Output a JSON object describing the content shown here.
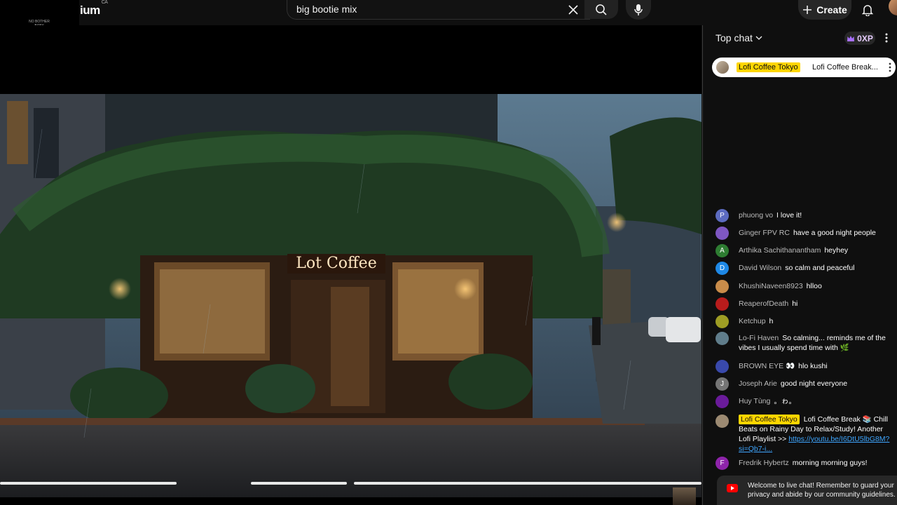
{
  "header": {
    "logo_tiny_text": "NO BOTHER BABY",
    "brand": "ium",
    "brand_region": "CA",
    "search_value": "big bootie mix",
    "create_label": "Create"
  },
  "video": {
    "sign_text": "Lot Coffee",
    "progress_fraction": 0.86
  },
  "chat": {
    "title": "Top chat",
    "xp": "0XP",
    "pinned": {
      "author": "Lofi Coffee Tokyo",
      "text": "Lofi Coffee Break..."
    },
    "messages": [
      {
        "author": "phuong vo",
        "text": "I love it!",
        "avatar": "P",
        "color": "#5c6bc0"
      },
      {
        "author": "Ginger FPV RC",
        "text": "have a good night people",
        "avatar": "",
        "color": "#7e57c2"
      },
      {
        "author": "Arthika Sachithanantham",
        "text": "heyhey",
        "avatar": "A",
        "color": "#2e7d32"
      },
      {
        "author": "David Wilson",
        "text": "so calm and peaceful",
        "avatar": "D",
        "color": "#1e88e5"
      },
      {
        "author": "KhushiNaveen8923",
        "text": "hlloo",
        "avatar": "",
        "color": "#c98c4a"
      },
      {
        "author": "ReaperofDeath",
        "text": "hi",
        "avatar": "",
        "color": "#b71c1c"
      },
      {
        "author": "Ketchup",
        "text": "h",
        "avatar": "",
        "color": "#9e9d24"
      },
      {
        "author": "Lo-Fi Haven",
        "text": "So calming... reminds me of the vibes I usually spend time with 🌿",
        "avatar": "",
        "color": "#607d8b"
      },
      {
        "author": "BROWN EYE 👀",
        "text": "hlo kushi",
        "avatar": "",
        "color": "#3949ab"
      },
      {
        "author": "Joseph Arie",
        "text": "good night everyone",
        "avatar": "J",
        "color": "#757575"
      },
      {
        "author": "Huy Tùng",
        "text": "。ゎ。",
        "avatar": "",
        "color": "#6a1b9a"
      },
      {
        "author": "Lofi Coffee Tokyo",
        "owner": true,
        "text": "Lofi Coffee Break 📚 Chill Beats on Rainy Day to Relax/Study! Another Lofi Playlist >> ",
        "link": "https://youtu.be/I6DtU5lbG8M?si=Qb7-i...",
        "avatar": "",
        "color": "#9c8a72"
      },
      {
        "author": "Fredrik Hybertz",
        "text": "morning morning guys!",
        "avatar": "F",
        "color": "#8e24aa"
      }
    ],
    "welcome": "Welcome to live chat! Remember to guard your privacy and abide by our community guidelines."
  }
}
